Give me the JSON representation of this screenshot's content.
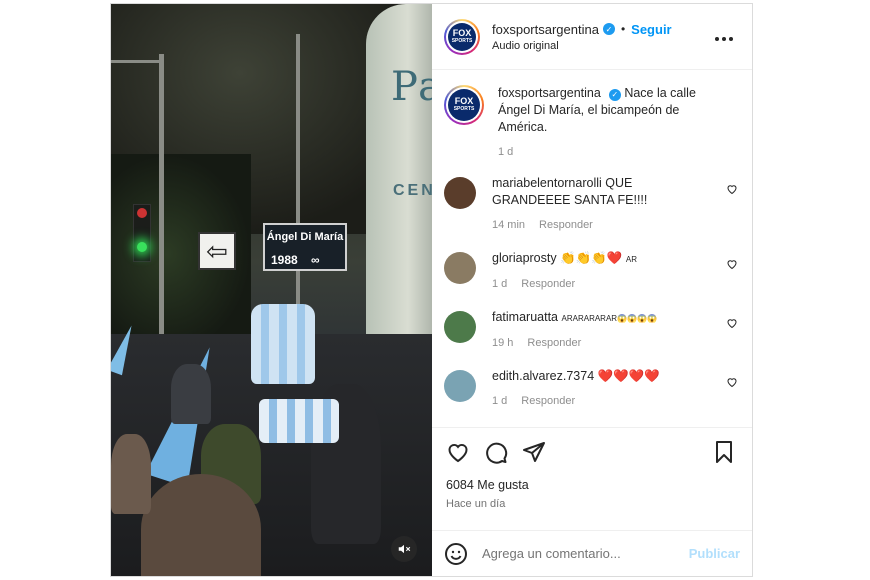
{
  "post": {
    "username": "foxsportsargentina",
    "verified": true,
    "follow_label": "Seguir",
    "separator": "•",
    "audio": "Audio original",
    "more_label": "•••",
    "avatar_logo": "FOX",
    "avatar_logo_sub": "SPORTS"
  },
  "media": {
    "building_text": "Par",
    "building_sub": "CEN",
    "street_sign_name": "Ángel Di María",
    "street_sign_year": "1988",
    "street_sign_symbol": "∞",
    "arrow": "⇦"
  },
  "caption": {
    "username": "foxsportsargentina",
    "text": "Nace la calle Ángel Di María, el bicampeón de América.",
    "time": "1 d"
  },
  "comments": [
    {
      "username": "mariabelentornarolli",
      "text": "QUE GRANDEEEE SANTA FE!!!!",
      "time": "14 min",
      "reply": "Responder",
      "avatar_color": "#5a3d2b"
    },
    {
      "username": "gloriaprosty",
      "text": "👏👏👏❤️",
      "suffix": "AR",
      "time": "1 d",
      "reply": "Responder",
      "avatar_color": "#8a7b63"
    },
    {
      "username": "fatimaruatta",
      "text": "ARARARARAR😱😱😱😱",
      "time": "19 h",
      "reply": "Responder",
      "avatar_color": "#4d7a4a"
    },
    {
      "username": "edith.alvarez.7374",
      "text": "❤️❤️❤️❤️",
      "time": "1 d",
      "reply": "Responder",
      "avatar_color": "#7aa3b3"
    }
  ],
  "actions": {
    "likes": "6084 Me gusta",
    "date": "Hace un día"
  },
  "add_comment": {
    "placeholder": "Agrega un comentario...",
    "publish": "Publicar"
  },
  "colors": {
    "accent": "#0095f6",
    "publish_disabled": "#b2dffc",
    "verified": "#1d9bf0"
  }
}
